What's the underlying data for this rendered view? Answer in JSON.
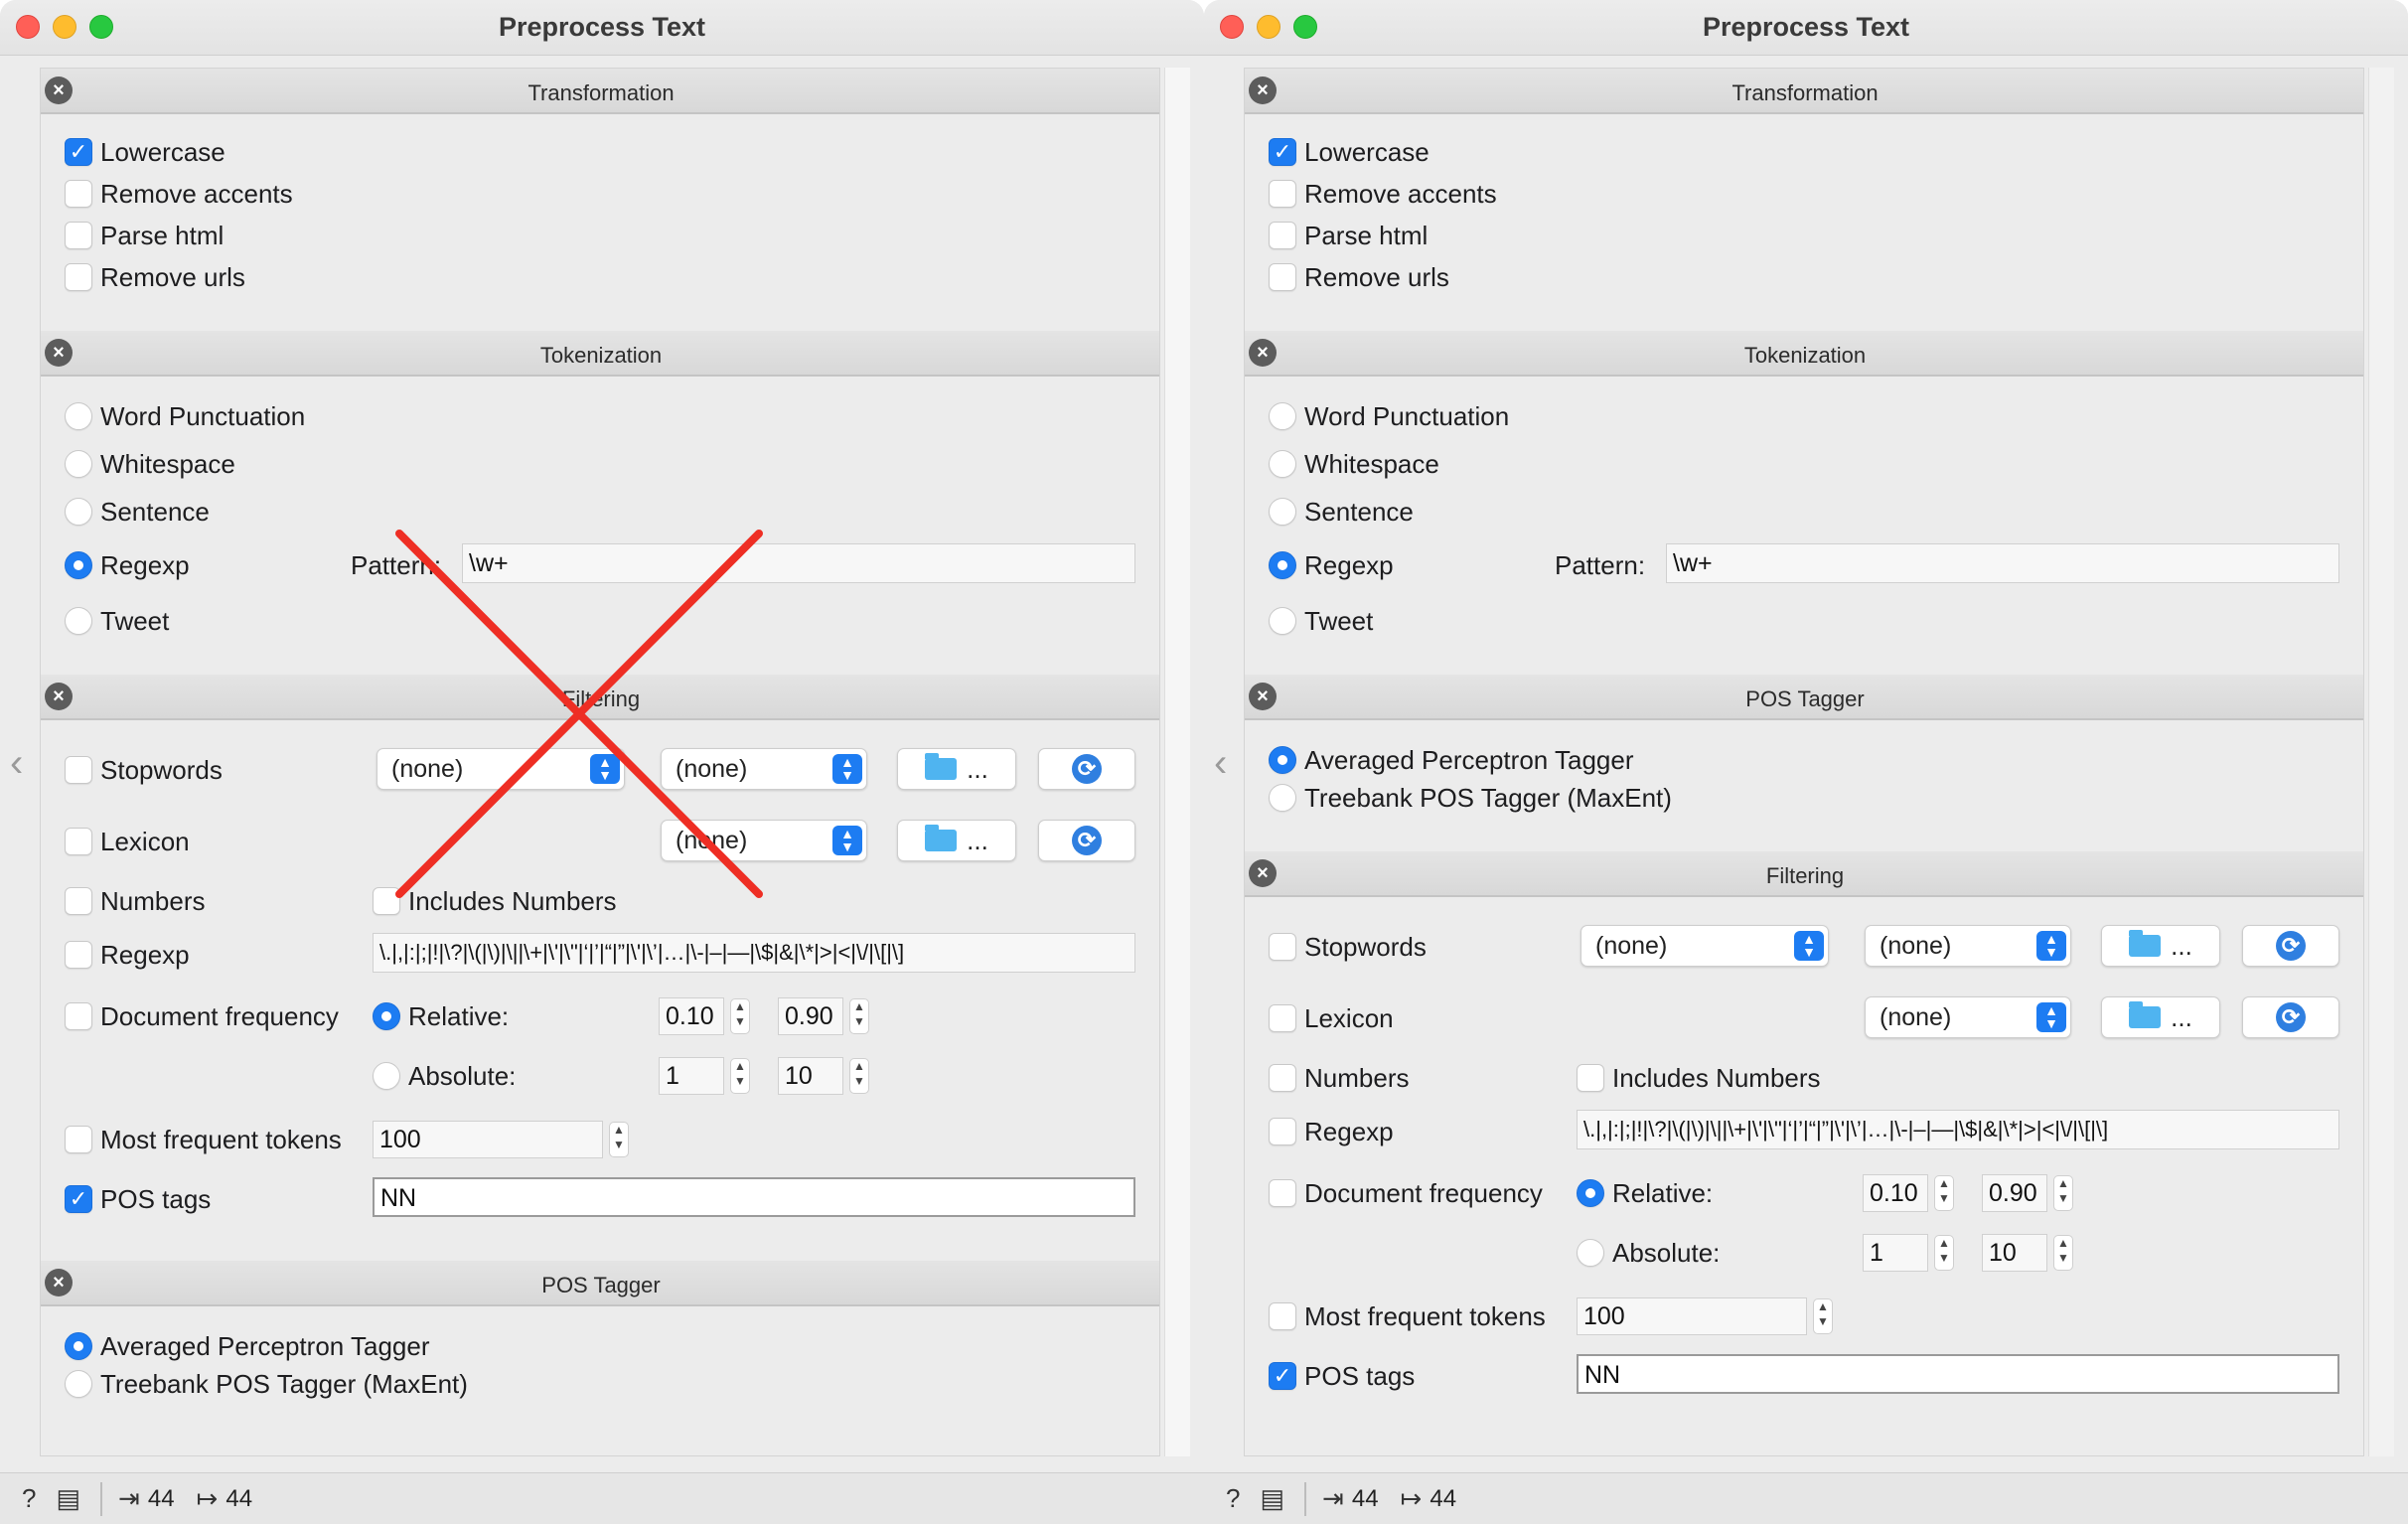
{
  "window_title": "Preprocess Text",
  "sections": {
    "transformation": "Transformation",
    "tokenization": "Tokenization",
    "filtering": "Filtering",
    "pos_tagger": "POS Tagger"
  },
  "transformation": {
    "lowercase": "Lowercase",
    "remove_accents": "Remove accents",
    "parse_html": "Parse html",
    "remove_urls": "Remove urls"
  },
  "tokenization": {
    "word_punctuation": "Word  Punctuation",
    "whitespace": "Whitespace",
    "sentence": "Sentence",
    "regexp": "Regexp",
    "tweet": "Tweet",
    "pattern_label": "Pattern:",
    "pattern_value": "\\w+"
  },
  "filtering": {
    "stopwords": "Stopwords",
    "lexicon": "Lexicon",
    "numbers": "Numbers",
    "includes_numbers": "Includes Numbers",
    "regexp": "Regexp",
    "regexp_value": "\\.|,|:|;|!|\\?|\\(|\\)|\\||\\+|\\'|\\\"|‘|’|“|”|\\'|\\’|…|\\-|–|—|\\$|&|\\*|>|<|\\/|\\[|\\]",
    "document_frequency": "Document frequency",
    "relative": "Relative:",
    "absolute": "Absolute:",
    "rel_min": "0.10",
    "rel_max": "0.90",
    "abs_min": "1",
    "abs_max": "10",
    "most_frequent_tokens": "Most frequent tokens",
    "most_frequent_value": "100",
    "pos_tags": "POS tags",
    "pos_tags_value": "NN",
    "popup_none": "(none)",
    "dots": "..."
  },
  "pos_tagger": {
    "averaged": "Averaged Perceptron Tagger",
    "treebank": "Treebank POS Tagger (MaxEnt)"
  },
  "status": {
    "input_count": "44",
    "output_count": "44"
  },
  "colors": {
    "accent": "#1d7cf2",
    "cross": "#ee2e24"
  }
}
